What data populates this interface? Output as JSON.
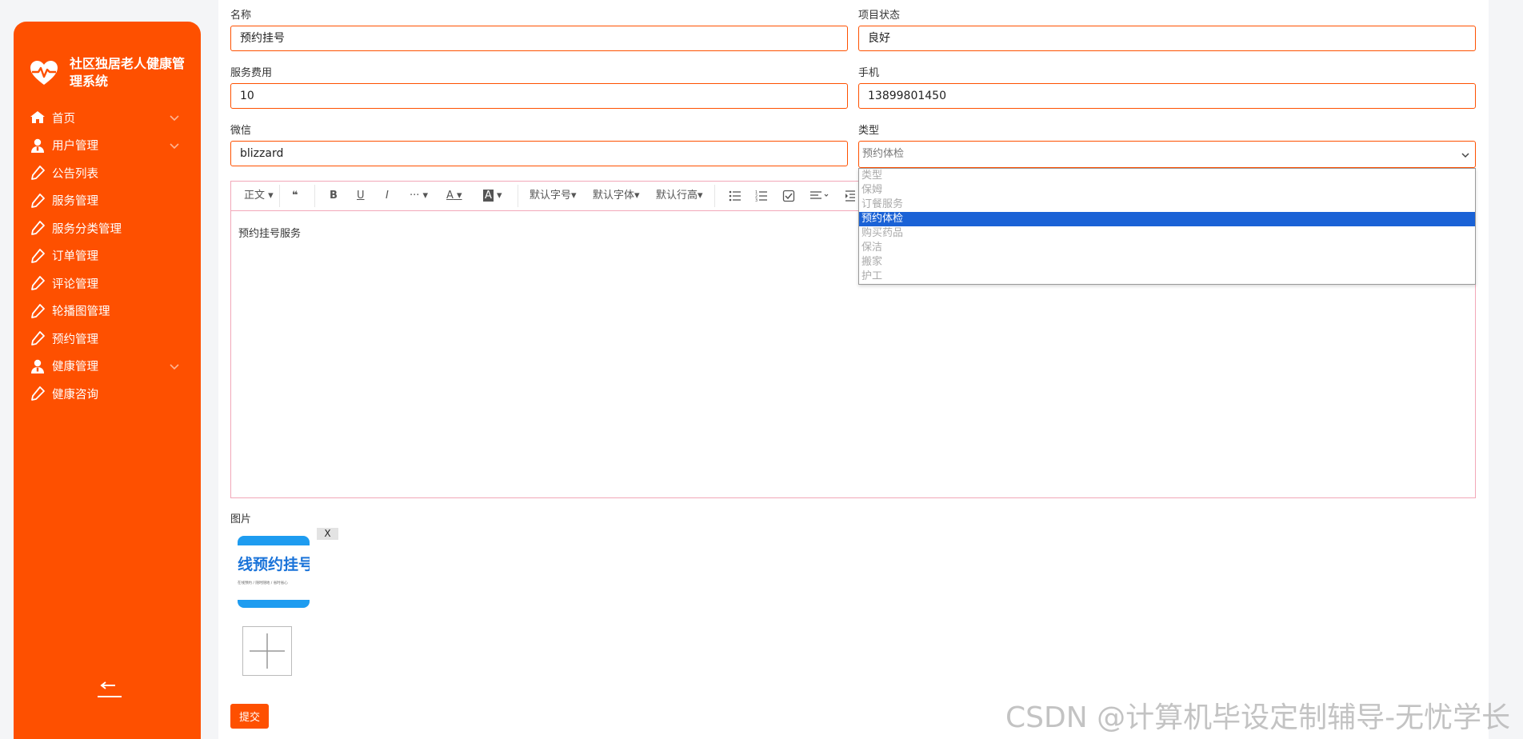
{
  "app": {
    "title": "社区独居老人健康管理系统"
  },
  "sidebar": {
    "items": [
      {
        "label": "首页",
        "icon": "home-icon",
        "expandable": true
      },
      {
        "label": "用户管理",
        "icon": "user-icon",
        "expandable": true
      },
      {
        "label": "公告列表",
        "icon": "pen-icon",
        "expandable": false
      },
      {
        "label": "服务管理",
        "icon": "pen-icon",
        "expandable": false
      },
      {
        "label": "服务分类管理",
        "icon": "pen-icon",
        "expandable": false
      },
      {
        "label": "订单管理",
        "icon": "pen-icon",
        "expandable": false
      },
      {
        "label": "评论管理",
        "icon": "pen-icon",
        "expandable": false
      },
      {
        "label": "轮播图管理",
        "icon": "pen-icon",
        "expandable": false
      },
      {
        "label": "预约管理",
        "icon": "pen-icon",
        "expandable": false
      },
      {
        "label": "健康管理",
        "icon": "user-icon",
        "expandable": true
      },
      {
        "label": "健康咨询",
        "icon": "pen-icon",
        "expandable": false
      }
    ]
  },
  "form": {
    "name": {
      "label": "名称",
      "value": "预约挂号"
    },
    "status": {
      "label": "项目状态",
      "value": "良好"
    },
    "fee": {
      "label": "服务费用",
      "value": "10"
    },
    "phone": {
      "label": "手机",
      "value": "13899801450"
    },
    "wechat": {
      "label": "微信",
      "value": "blizzard"
    },
    "type": {
      "label": "类型",
      "value": "预约体检",
      "options": [
        "类型",
        "保姆",
        "订餐服务",
        "预约体检",
        "购买药品",
        "保洁",
        "搬家",
        "护工"
      ],
      "selected_index": 3
    },
    "editor": {
      "toolbar": {
        "paragraph": "正文",
        "quote": "❝",
        "bold": "B",
        "underline": "U",
        "italic": "I",
        "more": "···",
        "font_color": "A",
        "bg_color": "A",
        "font_size": "默认字号",
        "font_family": "默认字体",
        "line_height": "默认行高"
      },
      "content": "预约挂号服务"
    },
    "picture": {
      "label": "图片",
      "thumb_text": "线预约挂号",
      "thumb_subtext": "在线预约 / 随时随地 / 省时省心",
      "remove": "X"
    },
    "submit": "提交"
  },
  "watermark": "CSDN @计算机毕设定制辅导-无忧学长",
  "colors": {
    "accent": "#fe5000",
    "selected_option": "#1a62d6",
    "editor_border": "#f2a7b8"
  }
}
